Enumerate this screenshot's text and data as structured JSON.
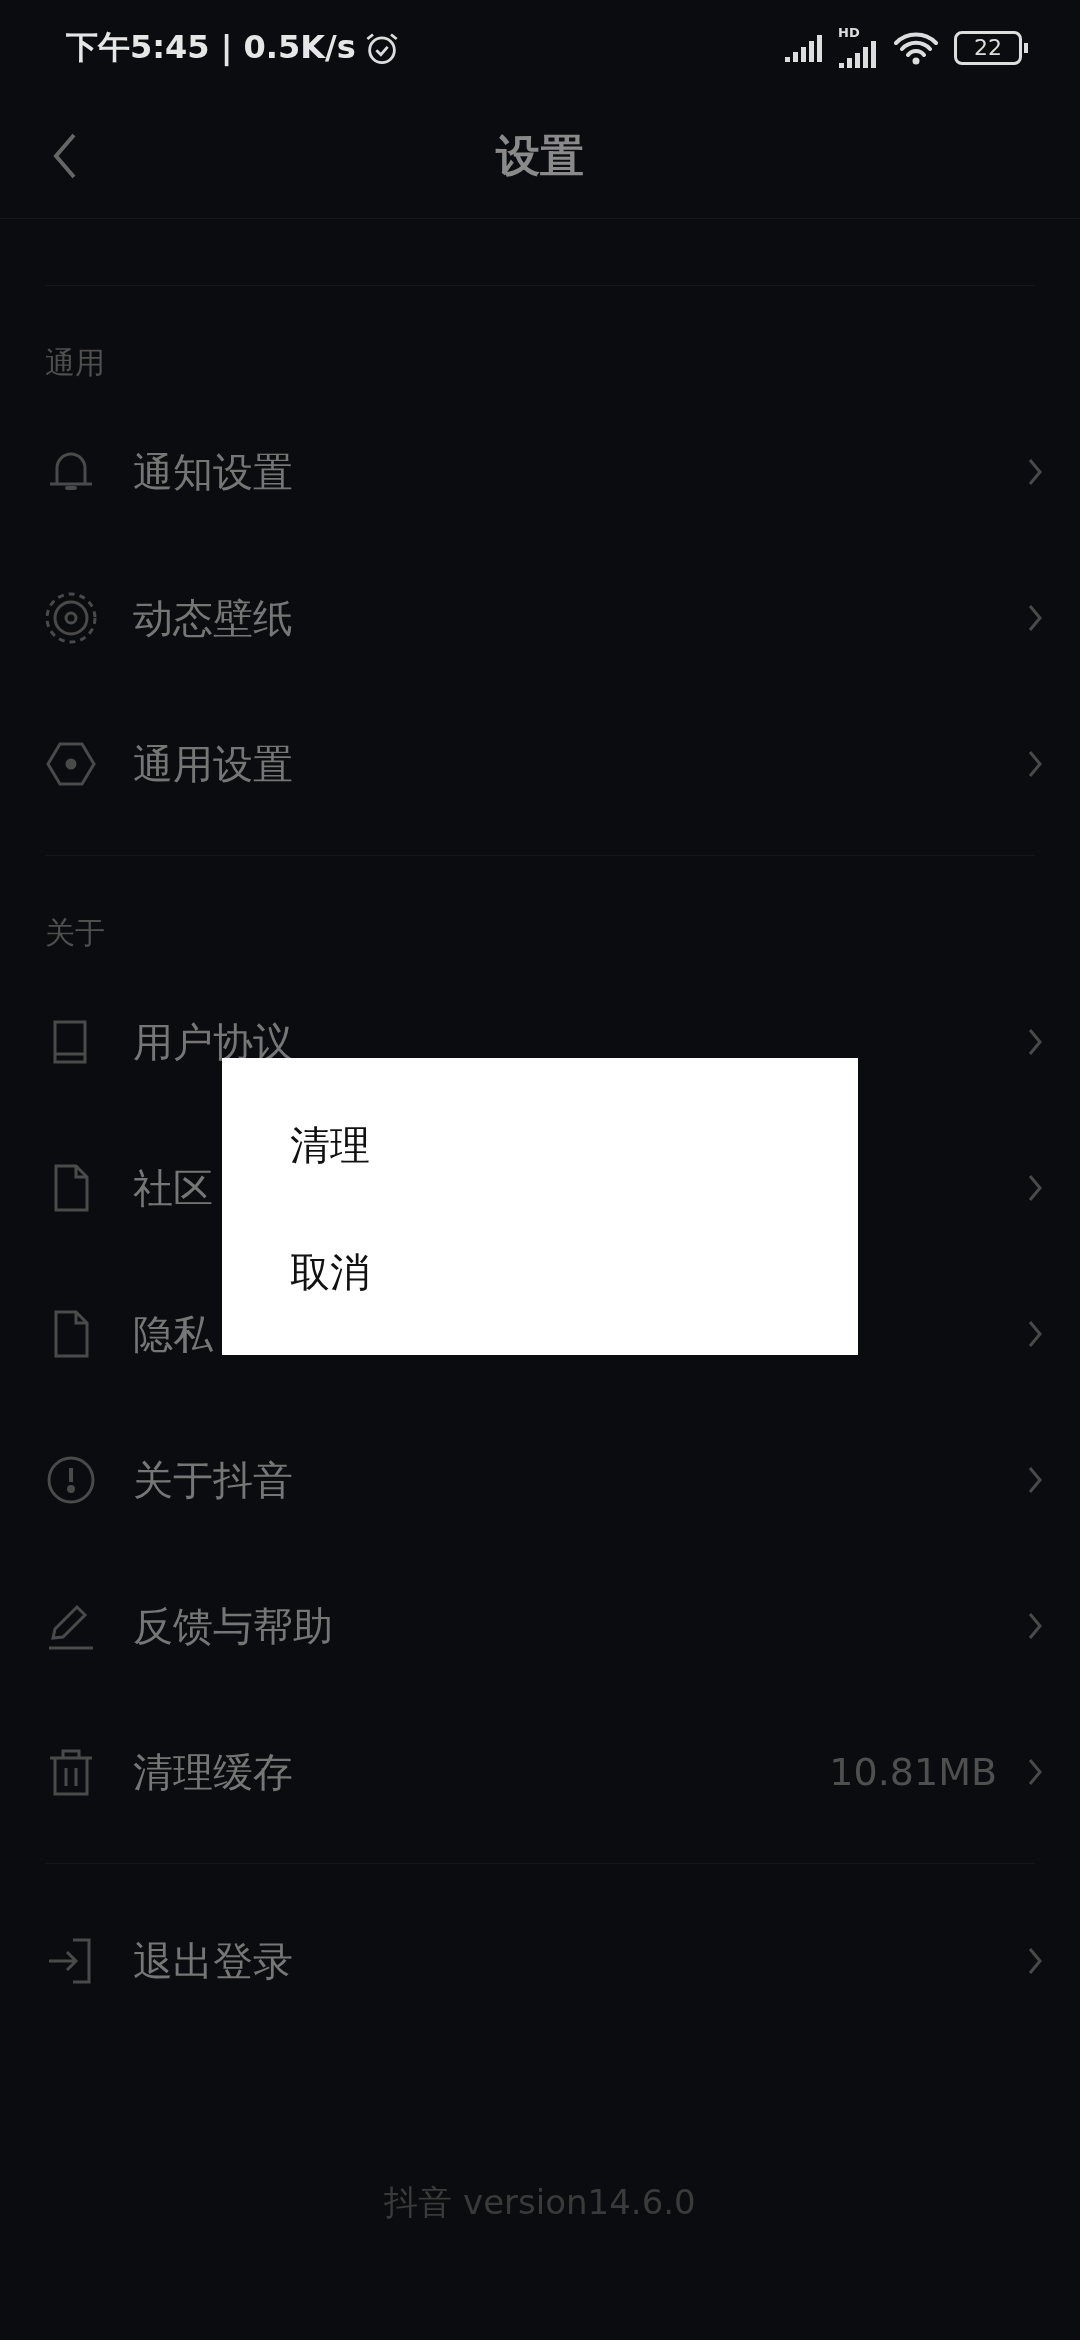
{
  "status_bar": {
    "time_and_speed": "下午5:45 | 0.5K/s",
    "hd_label": "HD",
    "battery": "22"
  },
  "header": {
    "title": "设置"
  },
  "sections": [
    {
      "label": "通用",
      "items": [
        {
          "kind": "bell",
          "label": "通知设置"
        },
        {
          "kind": "target",
          "label": "动态壁纸"
        },
        {
          "kind": "hexagon",
          "label": "通用设置"
        }
      ]
    },
    {
      "label": "关于",
      "items": [
        {
          "kind": "book",
          "label": "用户协议"
        },
        {
          "kind": "file",
          "label": "社区"
        },
        {
          "kind": "file",
          "label": "隐私"
        },
        {
          "kind": "alert",
          "label": "关于抖音"
        },
        {
          "kind": "pencil",
          "label": "反馈与帮助"
        },
        {
          "kind": "trash",
          "label": "清理缓存",
          "value": "10.81MB"
        }
      ]
    },
    {
      "items": [
        {
          "kind": "logout",
          "label": "退出登录"
        }
      ]
    }
  ],
  "footer": "抖音 version14.6.0",
  "dialog": {
    "options": [
      "清理",
      "取消"
    ]
  }
}
